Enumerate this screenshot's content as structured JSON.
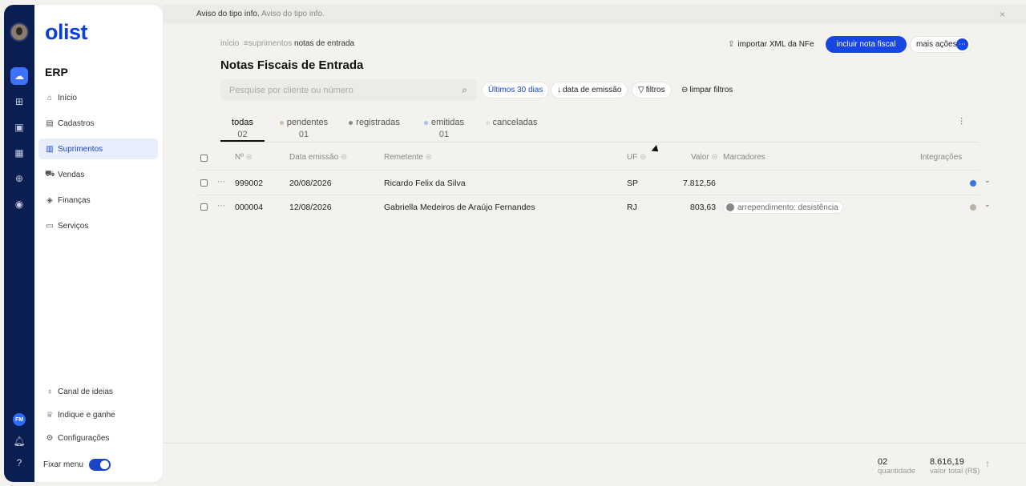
{
  "banner": {
    "label": "Aviso do tipo info.",
    "detail": "Aviso do tipo info.",
    "close": "×"
  },
  "brand": {
    "logo": "olist",
    "module": "ERP"
  },
  "rail": {
    "user_initials": "FM"
  },
  "nav": [
    {
      "label": "Início",
      "icon": "home-icon"
    },
    {
      "label": "Cadastros",
      "icon": "address-book-icon"
    },
    {
      "label": "Suprimentos",
      "icon": "clipboard-icon"
    },
    {
      "label": "Vendas",
      "icon": "cart-icon"
    },
    {
      "label": "Finanças",
      "icon": "money-icon"
    },
    {
      "label": "Serviços",
      "icon": "briefcase-icon"
    }
  ],
  "bottom_nav": [
    {
      "label": "Canal de ideias",
      "icon": "lightbulb-icon"
    },
    {
      "label": "Indique e ganhe",
      "icon": "trophy-icon"
    },
    {
      "label": "Configurações",
      "icon": "gear-icon"
    }
  ],
  "fix_menu": "Fixar menu",
  "breadcrumb": {
    "home": "início",
    "section": "suprimentos",
    "current": "notas de entrada"
  },
  "page_title": "Notas Fiscais de Entrada",
  "actions": {
    "import_xml": "importar XML da NFe",
    "primary": "incluir nota fiscal",
    "more": "mais ações"
  },
  "search": {
    "placeholder": "Pesquise por cliente ou número"
  },
  "filters": {
    "period": "Últimos 30 dias",
    "sort": "data de emissão",
    "filters": "filtros",
    "clear": "limpar filtros"
  },
  "tabs": [
    {
      "label": "todas",
      "count": "02"
    },
    {
      "label": "pendentes",
      "count": "01"
    },
    {
      "label": "registradas",
      "count": ""
    },
    {
      "label": "emitidas",
      "count": "01"
    },
    {
      "label": "canceladas",
      "count": ""
    }
  ],
  "table": {
    "headers": {
      "number": "Nº",
      "date": "Data emissão",
      "sender": "Remetente",
      "uf": "UF",
      "value": "Valor",
      "markers": "Marcadores",
      "integrations": "Integrações"
    },
    "rows": [
      {
        "number": "999002",
        "date": "20/08/2026",
        "sender": "Ricardo Felix da Silva",
        "uf": "SP",
        "value": "7.812,56",
        "marker": "",
        "integration_color": "#3d71e6"
      },
      {
        "number": "000004",
        "date": "12/08/2026",
        "sender": "Gabriella Medeiros de Araújo Fernandes",
        "uf": "RJ",
        "value": "803,63",
        "marker": "arrependimento: desistência",
        "integration_color": "#b9b5ab"
      }
    ]
  },
  "footer": {
    "quantity": "02",
    "quantity_label": "quantidade",
    "total": "8.616,19",
    "total_label": "valor total (R$)"
  },
  "colors": {
    "primary": "#1746e3",
    "rail": "#0b1e52",
    "background": "#f3f2ee"
  }
}
